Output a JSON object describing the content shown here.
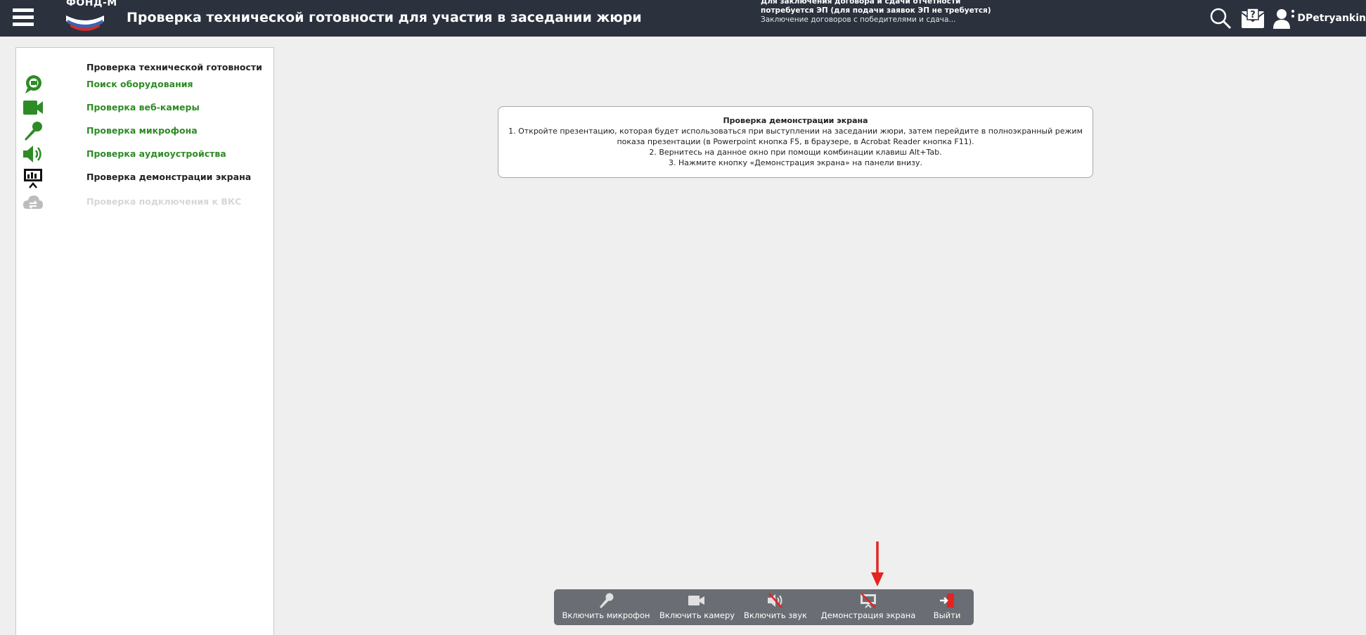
{
  "header": {
    "logo_text": "ФОНД-М",
    "title": "Проверка технической готовности для участия в заседании жюри",
    "notice_line1": "Для заключения договора и сдачи отчетности",
    "notice_line2": "потребуется ЭП (для подачи заявок ЭП не требуется)",
    "notice_line3": "Заключение договоров с победителями и сдача...",
    "username": "DPetryankin"
  },
  "sidebar": {
    "title": "Проверка технической готовности",
    "steps": [
      {
        "label": "Поиск оборудования",
        "state": "done",
        "icon": "chat-bubble-icon"
      },
      {
        "label": "Проверка веб-камеры",
        "state": "done",
        "icon": "video-camera-icon"
      },
      {
        "label": "Проверка микрофона",
        "state": "done",
        "icon": "microphone-icon"
      },
      {
        "label": "Проверка аудиоустройства",
        "state": "done",
        "icon": "speaker-icon"
      },
      {
        "label": "Проверка демонстрации экрана",
        "state": "current",
        "icon": "screen-share-icon"
      },
      {
        "label": "Проверка подключения к ВКС",
        "state": "pending",
        "icon": "cloud-sync-icon"
      }
    ]
  },
  "info": {
    "title": "Проверка демонстрации экрана",
    "line1": "1. Откройте презентацию, которая будет использоваться при выступлении на заседании жюри, затем перейдите в полноэкранный режим",
    "line2": "показа презентации (в Powerpoint кнопка F5, в браузере, в Acrobat Reader кнопка F11).",
    "line3": "2. Вернитесь на данное окно при помощи комбинации клавиш Alt+Tab.",
    "line4": "3. Нажмите кнопку «Демонстрация экрана» на панели внизу."
  },
  "toolbar": {
    "mic_label": "Включить микрофон",
    "camera_label": "Включить камеру",
    "sound_label": "Включить звук",
    "screen_label": "Демонстрация экрана",
    "exit_label": "Выйти"
  },
  "colors": {
    "topbar": "#2b323d",
    "done_green": "#2e8b25",
    "toolbar": "#6a6d73",
    "accent_red": "#e32421"
  }
}
